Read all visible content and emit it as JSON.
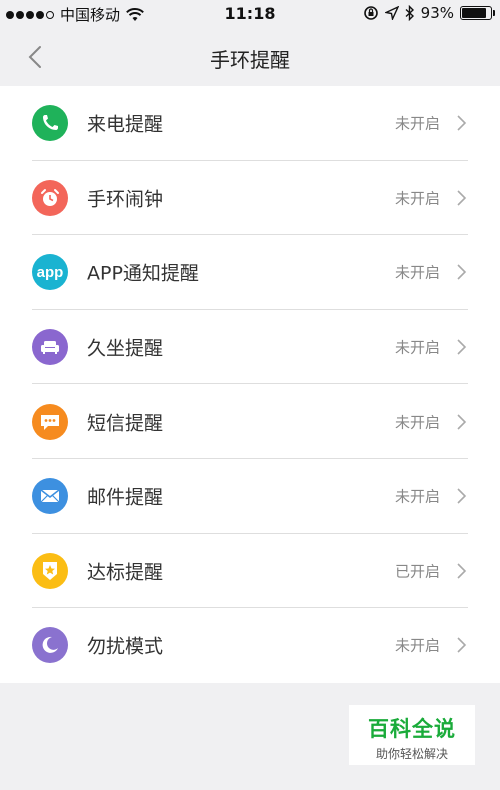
{
  "status_bar": {
    "carrier": "中国移动",
    "time": "11:18",
    "battery": "93%",
    "battery_level": 0.93
  },
  "nav": {
    "title": "手环提醒"
  },
  "items": [
    {
      "label": "来电提醒",
      "status": "未开启",
      "icon": "phone-icon",
      "color": "#1fb25a"
    },
    {
      "label": "手环闹钟",
      "status": "未开启",
      "icon": "alarm-clock-icon",
      "color": "#f3665a"
    },
    {
      "label": "APP通知提醒",
      "status": "未开启",
      "icon": "app-icon",
      "icon_text": "app",
      "color": "#1ab3d1"
    },
    {
      "label": "久坐提醒",
      "status": "未开启",
      "icon": "sofa-icon",
      "color": "#8a67cf"
    },
    {
      "label": "短信提醒",
      "status": "未开启",
      "icon": "message-icon",
      "color": "#f68b1f"
    },
    {
      "label": "邮件提醒",
      "status": "未开启",
      "icon": "mail-icon",
      "color": "#3d90e0"
    },
    {
      "label": "达标提醒",
      "status": "已开启",
      "icon": "badge-star-icon",
      "color": "#fbbd14"
    },
    {
      "label": "勿扰模式",
      "status": "未开启",
      "icon": "moon-icon",
      "color": "#8a72cf"
    }
  ],
  "watermark": {
    "title": "百科全说",
    "subtitle": "助你轻松解决"
  }
}
